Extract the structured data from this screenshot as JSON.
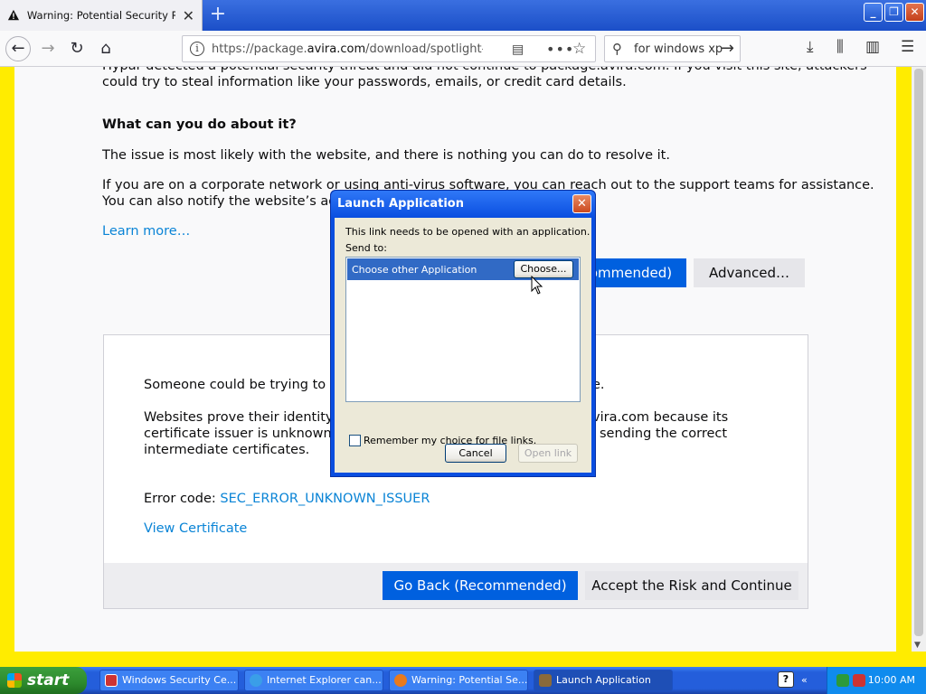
{
  "browser": {
    "tab_title": "Warning: Potential Security Risk A",
    "tab_close": "✕",
    "new_tab": "+",
    "url_prefix": "https://package.",
    "url_domain": "avira.com",
    "url_path": "/download/spotlight-wind",
    "search_query": "for windows xp",
    "window_buttons": [
      "_",
      "❐",
      "✕"
    ]
  },
  "page": {
    "intro_line1": "Hypar detected a potential security threat and did not continue to package.avira.com. If you visit this site, attackers",
    "intro_line2": "could try to steal information like your passwords, emails, or credit card details.",
    "heading": "What can you do about it?",
    "para1": "The issue is most likely with the website, and there is nothing you can do to resolve it.",
    "para2_line1": "If you are on a corporate network or using anti-virus software, you can reach out to the support teams for assistance.",
    "para2_line2": "You can also notify the website’s admi",
    "learn_more": "Learn more…",
    "go_back_top": "ommended)",
    "advanced": "Advanced…",
    "panel_line1a": "Someone could be trying to imp",
    "panel_line1b": "e.",
    "panel_line2a": "Websites prove their identity via",
    "panel_line2b": "vira.com because its",
    "panel_line3a": "certificate issuer is unknown, the",
    "panel_line3b": "sending the correct",
    "panel_line4": "intermediate certificates.",
    "error_label": "Error code: ",
    "error_code": "SEC_ERROR_UNKNOWN_ISSUER",
    "view_certificate": "View Certificate",
    "go_back": "Go Back (Recommended)",
    "accept_risk": "Accept the Risk and Continue"
  },
  "dialog": {
    "title": "Launch Application",
    "close": "✕",
    "message": "This link needs to be opened with an application.",
    "send_to": "Send to:",
    "selected_item": "Choose other Application",
    "choose_button": "Choose...",
    "remember": "Remember my choice for file links.",
    "cancel": "Cancel",
    "open_link": "Open link"
  },
  "taskbar": {
    "start": "start",
    "tasks": [
      "Windows Security Ce...",
      "Internet Explorer can...",
      "Warning: Potential Se...",
      "Launch Application"
    ],
    "time": "10:00 AM"
  },
  "colors": {
    "accent_blue": "#0060df",
    "link_blue": "#0a84d6",
    "background_yellow": "#ffec00",
    "xp_blue": "#245edb"
  }
}
